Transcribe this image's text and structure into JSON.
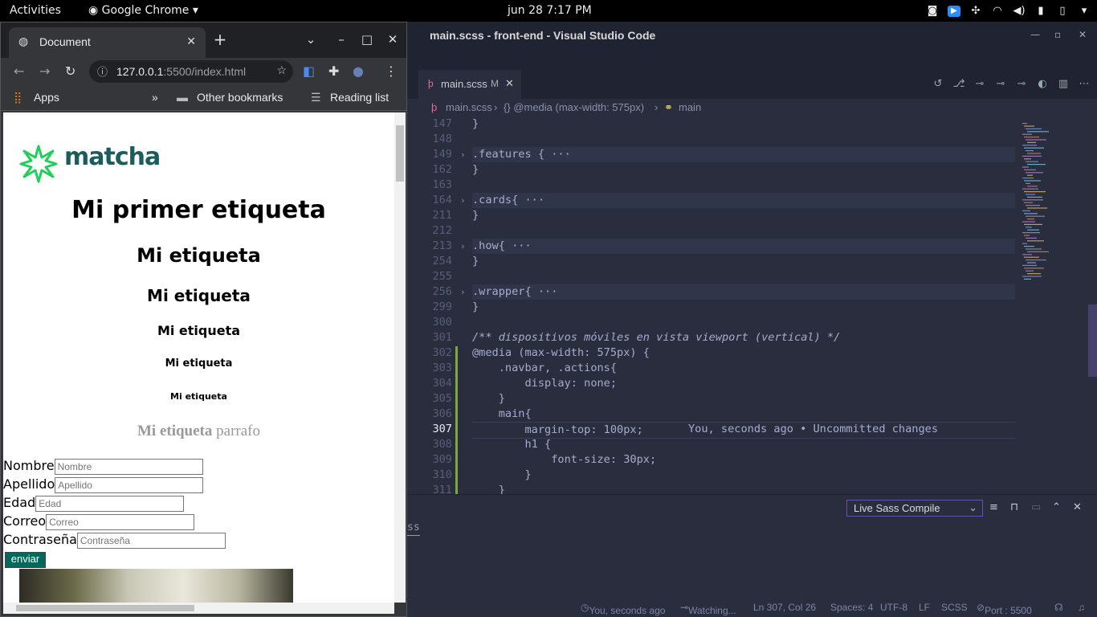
{
  "topbar": {
    "activities": "Activities",
    "app": "Google Chrome",
    "clock": "jun 28   7:17 PM"
  },
  "vscode": {
    "title": "main.scss - front-end - Visual Studio Code",
    "tab": {
      "name": "main.scss",
      "modified": "M"
    },
    "breadcrumb": [
      "main.scss",
      "{} @media (max-width: 575px)",
      "main"
    ],
    "lines": [
      {
        "n": "147",
        "fold": "",
        "code": "}",
        "cls": "c-pl"
      },
      {
        "n": "148",
        "fold": "",
        "code": "",
        "cls": "c-pl"
      },
      {
        "n": "149",
        "fold": "›",
        "code": ".features { ···",
        "cls": "c-sel",
        "fl": true
      },
      {
        "n": "162",
        "fold": "",
        "code": "}",
        "cls": "c-pl"
      },
      {
        "n": "163",
        "fold": "",
        "code": "",
        "cls": "c-pl"
      },
      {
        "n": "164",
        "fold": "›",
        "code": ".cards{ ···",
        "cls": "c-sel",
        "fl": true
      },
      {
        "n": "211",
        "fold": "",
        "code": "}",
        "cls": "c-pl"
      },
      {
        "n": "212",
        "fold": "",
        "code": "",
        "cls": "c-pl"
      },
      {
        "n": "213",
        "fold": "›",
        "code": ".how{ ···",
        "cls": "c-sel",
        "fl": true
      },
      {
        "n": "254",
        "fold": "",
        "code": "}",
        "cls": "c-pl"
      },
      {
        "n": "255",
        "fold": "",
        "code": "",
        "cls": "c-pl"
      },
      {
        "n": "256",
        "fold": "›",
        "code": ".wrapper{ ···",
        "cls": "c-sel",
        "fl": true
      },
      {
        "n": "299",
        "fold": "",
        "code": "}",
        "cls": "c-pl"
      },
      {
        "n": "300",
        "fold": "",
        "code": "",
        "cls": "c-pl"
      },
      {
        "n": "301",
        "fold": "",
        "code": "/** dispositivos móviles en vista viewport (vertical) */",
        "cls": "c-cm"
      },
      {
        "n": "302",
        "fold": "",
        "code": "@media (max-width: 575px) {",
        "cls": "c-at"
      },
      {
        "n": "303",
        "fold": "",
        "code": "    .navbar, .actions{",
        "cls": "c-sel"
      },
      {
        "n": "304",
        "fold": "",
        "code": "        display: none;",
        "cls": "c-pr"
      },
      {
        "n": "305",
        "fold": "",
        "code": "    }",
        "cls": "c-at"
      },
      {
        "n": "306",
        "fold": "",
        "code": "    main{",
        "cls": "c-tag"
      },
      {
        "n": "307",
        "fold": "",
        "code": "        margin-top: 100px;",
        "cls": "c-pr",
        "cur": true,
        "ghost": "You, seconds ago • Uncommitted changes"
      },
      {
        "n": "308",
        "fold": "",
        "code": "        h1 {",
        "cls": "c-tag"
      },
      {
        "n": "309",
        "fold": "",
        "code": "            font-size: 30px;",
        "cls": "c-pr"
      },
      {
        "n": "310",
        "fold": "",
        "code": "        }",
        "cls": "c-val"
      },
      {
        "n": "311",
        "fold": "",
        "code": "    }",
        "cls": "c-at"
      }
    ],
    "panel": {
      "select": "Live Sass Compile",
      "tab": "ss"
    },
    "status": {
      "blame": "You, seconds ago",
      "watch": "Watching...",
      "pos": "Ln 307, Col 26",
      "spaces": "Spaces: 4",
      "enc": "UTF-8",
      "eol": "LF",
      "lang": "SCSS",
      "port": "Port : 5500"
    }
  },
  "chrome": {
    "tab_title": "Document",
    "url_host": "127.0.0.1",
    "url_path": ":5500/index.html",
    "bookmarks": {
      "apps": "Apps",
      "more": "»",
      "other": "Other bookmarks",
      "reading": "Reading list"
    }
  },
  "site": {
    "logo_text": "matcha",
    "h1": "Mi primer etiqueta",
    "h2": "Mi etiqueta",
    "h3": "Mi etiqueta",
    "h4": "Mi etiqueta",
    "h5": "Mi etiqueta",
    "h6": "Mi etiqueta",
    "para_bold": "Mi etiqueta",
    "para_rest": " parrafo",
    "form": {
      "nombre_label": "Nombre",
      "nombre_ph": "Nombre",
      "apellido_label": "Apellido",
      "apellido_ph": "Apellido",
      "edad_label": "Edad",
      "edad_ph": "Edad",
      "correo_label": "Correo",
      "correo_ph": "Correo",
      "pass_label": "Contraseña",
      "pass_ph": "Contraseña",
      "submit": "enviar"
    }
  }
}
